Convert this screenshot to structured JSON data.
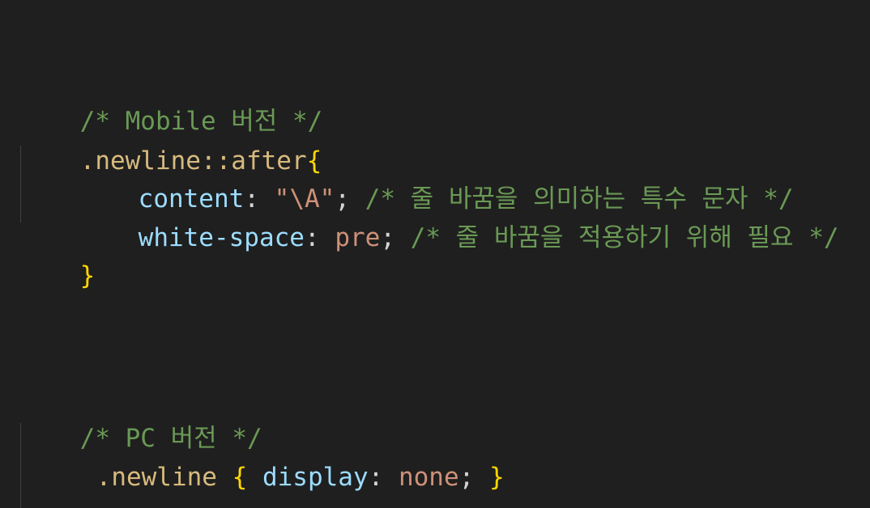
{
  "editor": {
    "theme_colors": {
      "background": "#1f1f1f",
      "comment": "#6a9955",
      "selector": "#d7ba7d",
      "brace": "#ffd700",
      "property": "#9cdcfe",
      "value": "#ce9178"
    },
    "mobile": {
      "comment": "/* Mobile 버전 */",
      "selector": ".newline::after",
      "open_brace": "{",
      "close_brace": "}",
      "decl1": {
        "property": "content",
        "colon": ":",
        "value": "\"\\A\"",
        "semicolon": ";",
        "comment": "/* 줄 바꿈을 의미하는 특수 문자 */"
      },
      "decl2": {
        "property": "white-space",
        "colon": ":",
        "value": "pre",
        "semicolon": ";",
        "comment": "/* 줄 바꿈을 적용하기 위해 필요 */"
      }
    },
    "pc": {
      "comment": "/* PC 버전 */",
      "selector": ".newline",
      "open_brace": "{",
      "property": "display",
      "colon": ":",
      "value": "none",
      "semicolon": ";",
      "close_brace": "}"
    }
  }
}
